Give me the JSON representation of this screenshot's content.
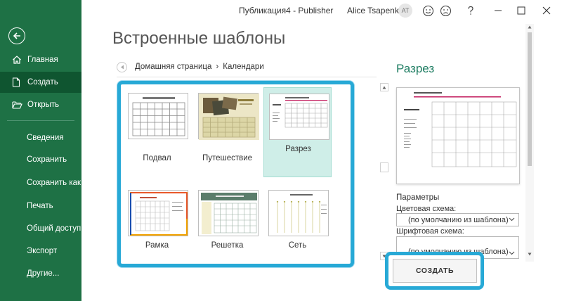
{
  "window": {
    "title": "Публикация4  -  Publisher",
    "user_name": "Alice Tsapenko",
    "user_initials": "AT"
  },
  "sidebar": {
    "items": [
      {
        "label": "Главная"
      },
      {
        "label": "Создать"
      },
      {
        "label": "Открыть"
      },
      {
        "label": "Сведения"
      },
      {
        "label": "Сохранить"
      },
      {
        "label": "Сохранить как"
      },
      {
        "label": "Печать"
      },
      {
        "label": "Общий доступ"
      },
      {
        "label": "Экспорт"
      },
      {
        "label": "Другие..."
      }
    ],
    "active_index": 1
  },
  "main": {
    "heading": "Встроенные шаблоны",
    "breadcrumb": {
      "home": "Домашняя страница",
      "separator": "›",
      "current": "Календари"
    },
    "templates": [
      {
        "label": "Подвал"
      },
      {
        "label": "Путешествие"
      },
      {
        "label": "Разрез",
        "selected": true
      },
      {
        "label": "Рамка"
      },
      {
        "label": "Решетка"
      },
      {
        "label": "Сеть"
      }
    ]
  },
  "preview": {
    "title": "Разрез",
    "params_title": "Параметры",
    "color_scheme_label": "Цветовая схема:",
    "color_scheme_value": "(по умолчанию из шаблона)",
    "font_scheme_label": "Шрифтовая схема:",
    "font_scheme_value": "(по умолчанию из шаблона)",
    "create_label": "СОЗДАТЬ"
  },
  "colors": {
    "sidebar": "#1e7145",
    "accent": "#1e7d62",
    "highlight": "#27a9d6",
    "selected_tile": "#cfeee8"
  }
}
